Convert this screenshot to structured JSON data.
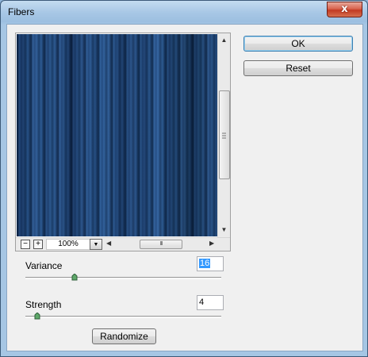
{
  "window": {
    "title": "Fibers",
    "close_glyph": "x"
  },
  "preview": {
    "zoom_out": "−",
    "zoom_in": "+",
    "zoom_value": "100%",
    "zoom_dropdown_icon": "chevron-down-icon",
    "up_arrow": "▲",
    "down_arrow": "▼",
    "left_arrow": "◀",
    "right_arrow": "▶",
    "scroll_grip": "III"
  },
  "buttons": {
    "ok": "OK",
    "reset": "Reset",
    "randomize": "Randomize"
  },
  "params": {
    "variance": {
      "label": "Variance",
      "value": "16",
      "level": 0.25
    },
    "strength": {
      "label": "Strength",
      "value": "4",
      "level": 0.06
    }
  },
  "colors": {
    "accent": "#3399ff",
    "preview_base": "#2c5c94"
  }
}
